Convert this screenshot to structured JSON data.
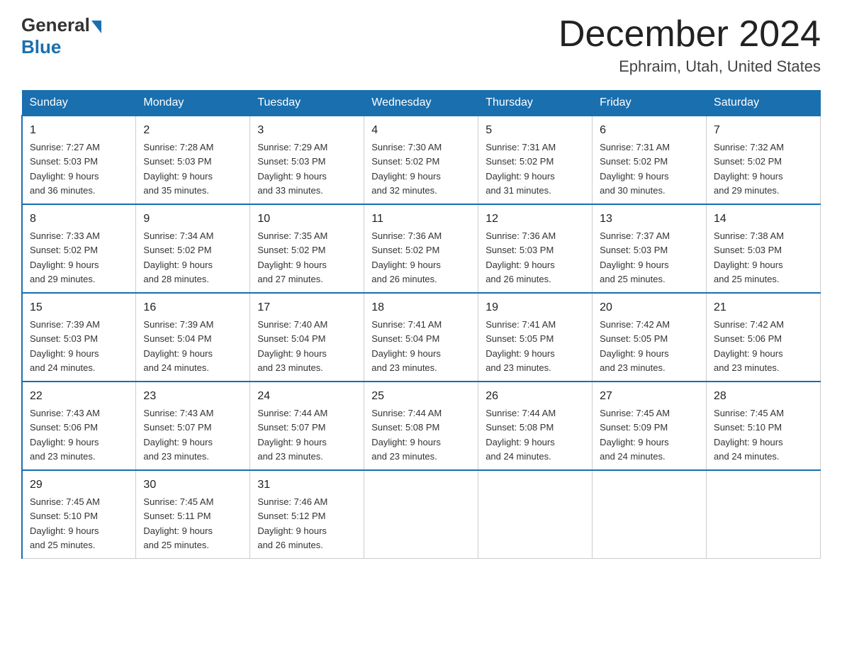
{
  "logo": {
    "general": "General",
    "blue": "Blue"
  },
  "header": {
    "month_year": "December 2024",
    "location": "Ephraim, Utah, United States"
  },
  "days_of_week": [
    "Sunday",
    "Monday",
    "Tuesday",
    "Wednesday",
    "Thursday",
    "Friday",
    "Saturday"
  ],
  "weeks": [
    [
      {
        "day": "1",
        "sunrise": "7:27 AM",
        "sunset": "5:03 PM",
        "daylight": "9 hours and 36 minutes."
      },
      {
        "day": "2",
        "sunrise": "7:28 AM",
        "sunset": "5:03 PM",
        "daylight": "9 hours and 35 minutes."
      },
      {
        "day": "3",
        "sunrise": "7:29 AM",
        "sunset": "5:03 PM",
        "daylight": "9 hours and 33 minutes."
      },
      {
        "day": "4",
        "sunrise": "7:30 AM",
        "sunset": "5:02 PM",
        "daylight": "9 hours and 32 minutes."
      },
      {
        "day": "5",
        "sunrise": "7:31 AM",
        "sunset": "5:02 PM",
        "daylight": "9 hours and 31 minutes."
      },
      {
        "day": "6",
        "sunrise": "7:31 AM",
        "sunset": "5:02 PM",
        "daylight": "9 hours and 30 minutes."
      },
      {
        "day": "7",
        "sunrise": "7:32 AM",
        "sunset": "5:02 PM",
        "daylight": "9 hours and 29 minutes."
      }
    ],
    [
      {
        "day": "8",
        "sunrise": "7:33 AM",
        "sunset": "5:02 PM",
        "daylight": "9 hours and 29 minutes."
      },
      {
        "day": "9",
        "sunrise": "7:34 AM",
        "sunset": "5:02 PM",
        "daylight": "9 hours and 28 minutes."
      },
      {
        "day": "10",
        "sunrise": "7:35 AM",
        "sunset": "5:02 PM",
        "daylight": "9 hours and 27 minutes."
      },
      {
        "day": "11",
        "sunrise": "7:36 AM",
        "sunset": "5:02 PM",
        "daylight": "9 hours and 26 minutes."
      },
      {
        "day": "12",
        "sunrise": "7:36 AM",
        "sunset": "5:03 PM",
        "daylight": "9 hours and 26 minutes."
      },
      {
        "day": "13",
        "sunrise": "7:37 AM",
        "sunset": "5:03 PM",
        "daylight": "9 hours and 25 minutes."
      },
      {
        "day": "14",
        "sunrise": "7:38 AM",
        "sunset": "5:03 PM",
        "daylight": "9 hours and 25 minutes."
      }
    ],
    [
      {
        "day": "15",
        "sunrise": "7:39 AM",
        "sunset": "5:03 PM",
        "daylight": "9 hours and 24 minutes."
      },
      {
        "day": "16",
        "sunrise": "7:39 AM",
        "sunset": "5:04 PM",
        "daylight": "9 hours and 24 minutes."
      },
      {
        "day": "17",
        "sunrise": "7:40 AM",
        "sunset": "5:04 PM",
        "daylight": "9 hours and 23 minutes."
      },
      {
        "day": "18",
        "sunrise": "7:41 AM",
        "sunset": "5:04 PM",
        "daylight": "9 hours and 23 minutes."
      },
      {
        "day": "19",
        "sunrise": "7:41 AM",
        "sunset": "5:05 PM",
        "daylight": "9 hours and 23 minutes."
      },
      {
        "day": "20",
        "sunrise": "7:42 AM",
        "sunset": "5:05 PM",
        "daylight": "9 hours and 23 minutes."
      },
      {
        "day": "21",
        "sunrise": "7:42 AM",
        "sunset": "5:06 PM",
        "daylight": "9 hours and 23 minutes."
      }
    ],
    [
      {
        "day": "22",
        "sunrise": "7:43 AM",
        "sunset": "5:06 PM",
        "daylight": "9 hours and 23 minutes."
      },
      {
        "day": "23",
        "sunrise": "7:43 AM",
        "sunset": "5:07 PM",
        "daylight": "9 hours and 23 minutes."
      },
      {
        "day": "24",
        "sunrise": "7:44 AM",
        "sunset": "5:07 PM",
        "daylight": "9 hours and 23 minutes."
      },
      {
        "day": "25",
        "sunrise": "7:44 AM",
        "sunset": "5:08 PM",
        "daylight": "9 hours and 23 minutes."
      },
      {
        "day": "26",
        "sunrise": "7:44 AM",
        "sunset": "5:08 PM",
        "daylight": "9 hours and 24 minutes."
      },
      {
        "day": "27",
        "sunrise": "7:45 AM",
        "sunset": "5:09 PM",
        "daylight": "9 hours and 24 minutes."
      },
      {
        "day": "28",
        "sunrise": "7:45 AM",
        "sunset": "5:10 PM",
        "daylight": "9 hours and 24 minutes."
      }
    ],
    [
      {
        "day": "29",
        "sunrise": "7:45 AM",
        "sunset": "5:10 PM",
        "daylight": "9 hours and 25 minutes."
      },
      {
        "day": "30",
        "sunrise": "7:45 AM",
        "sunset": "5:11 PM",
        "daylight": "9 hours and 25 minutes."
      },
      {
        "day": "31",
        "sunrise": "7:46 AM",
        "sunset": "5:12 PM",
        "daylight": "9 hours and 26 minutes."
      },
      null,
      null,
      null,
      null
    ]
  ],
  "labels": {
    "sunrise": "Sunrise:",
    "sunset": "Sunset:",
    "daylight": "Daylight:"
  }
}
